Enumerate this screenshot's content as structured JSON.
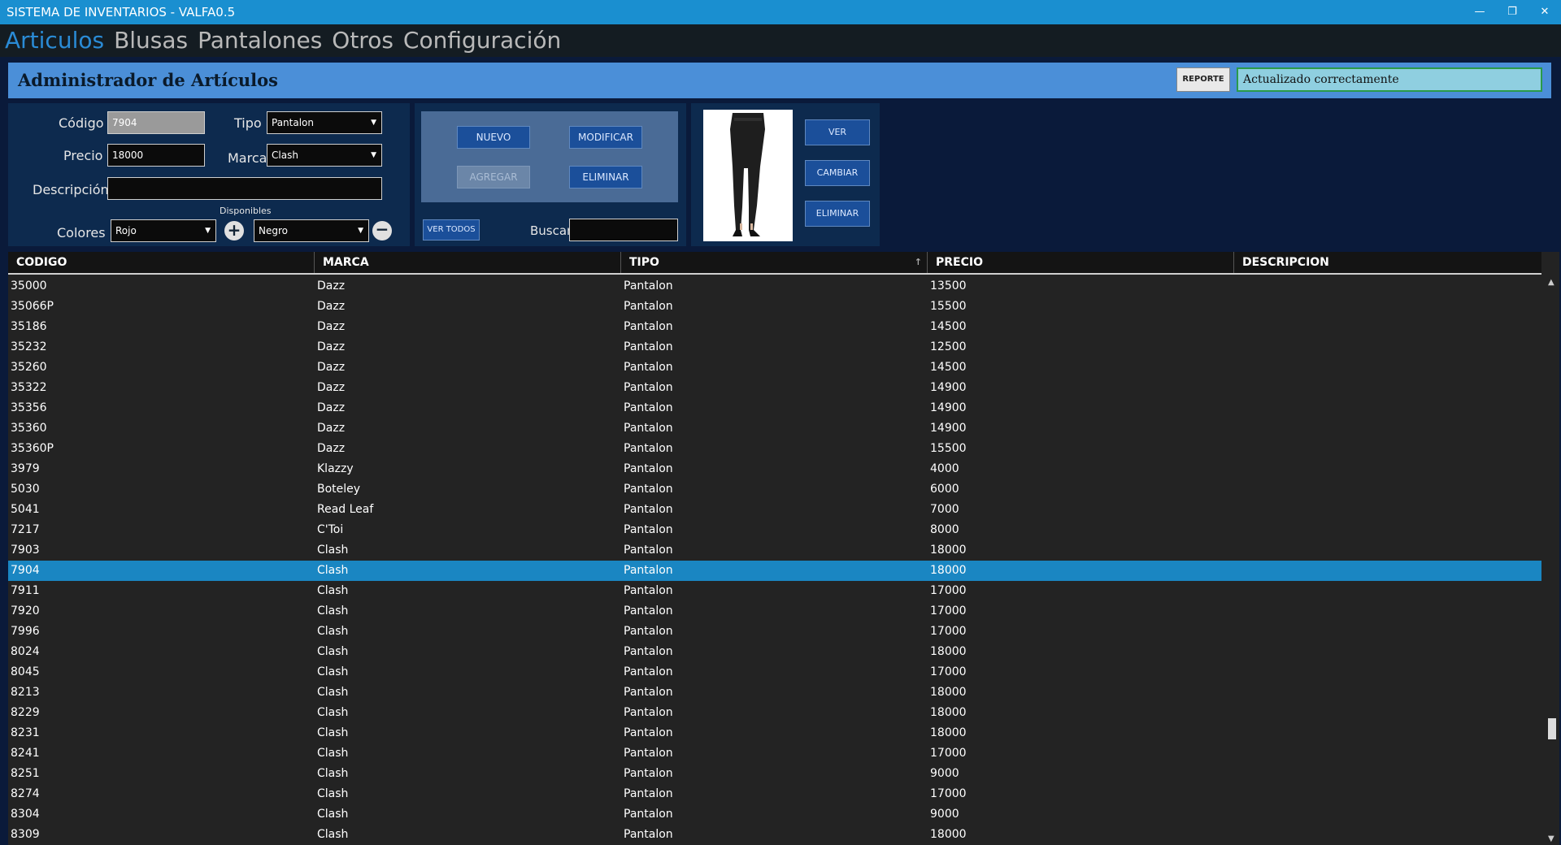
{
  "window": {
    "title": "SISTEMA DE INVENTARIOS - VALFA0.5"
  },
  "menu": {
    "items": [
      "Articulos",
      "Blusas",
      "Pantalones",
      "Otros",
      "Configuración"
    ],
    "active": "Articulos"
  },
  "header": {
    "title": "Administrador de Artículos",
    "report_button": "REPORTE",
    "status": "Actualizado correctamente"
  },
  "form": {
    "codigo_label": "Código",
    "codigo_value": "7904",
    "tipo_label": "Tipo",
    "tipo_value": "Pantalon",
    "precio_label": "Precio",
    "precio_value": "18000",
    "marca_label": "Marca",
    "marca_value": "Clash",
    "descripcion_label": "Descripción",
    "descripcion_value": "",
    "colores_label": "Colores",
    "colores_value": "Rojo",
    "disponibles_label": "Disponibles",
    "disponibles_value": "Negro"
  },
  "actions": {
    "nuevo": "NUEVO",
    "modificar": "MODIFICAR",
    "agregar": "AGREGAR",
    "eliminar": "ELIMINAR",
    "ver_todos": "VER TODOS",
    "buscar_label": "Buscar",
    "buscar_value": ""
  },
  "image_actions": {
    "ver": "VER",
    "cambiar": "CAMBIAR",
    "eliminar": "ELIMINAR"
  },
  "grid": {
    "columns": [
      "CODIGO",
      "MARCA",
      "TIPO",
      "PRECIO",
      "DESCRIPCION"
    ],
    "sorted_column": "TIPO",
    "selected_row": "7904",
    "rows": [
      [
        "35000",
        "Dazz",
        "Pantalon",
        "13500",
        ""
      ],
      [
        "35066P",
        "Dazz",
        "Pantalon",
        "15500",
        ""
      ],
      [
        "35186",
        "Dazz",
        "Pantalon",
        "14500",
        ""
      ],
      [
        "35232",
        "Dazz",
        "Pantalon",
        "12500",
        ""
      ],
      [
        "35260",
        "Dazz",
        "Pantalon",
        "14500",
        ""
      ],
      [
        "35322",
        "Dazz",
        "Pantalon",
        "14900",
        ""
      ],
      [
        "35356",
        "Dazz",
        "Pantalon",
        "14900",
        ""
      ],
      [
        "35360",
        "Dazz",
        "Pantalon",
        "14900",
        ""
      ],
      [
        "35360P",
        "Dazz",
        "Pantalon",
        "15500",
        ""
      ],
      [
        "3979",
        "Klazzy",
        "Pantalon",
        "4000",
        ""
      ],
      [
        "5030",
        "Boteley",
        "Pantalon",
        "6000",
        ""
      ],
      [
        "5041",
        "Read Leaf",
        "Pantalon",
        "7000",
        ""
      ],
      [
        "7217",
        "C'Toi",
        "Pantalon",
        "8000",
        ""
      ],
      [
        "7903",
        "Clash",
        "Pantalon",
        "18000",
        ""
      ],
      [
        "7904",
        "Clash",
        "Pantalon",
        "18000",
        ""
      ],
      [
        "7911",
        "Clash",
        "Pantalon",
        "17000",
        ""
      ],
      [
        "7920",
        "Clash",
        "Pantalon",
        "17000",
        ""
      ],
      [
        "7996",
        "Clash",
        "Pantalon",
        "17000",
        ""
      ],
      [
        "8024",
        "Clash",
        "Pantalon",
        "18000",
        ""
      ],
      [
        "8045",
        "Clash",
        "Pantalon",
        "17000",
        ""
      ],
      [
        "8213",
        "Clash",
        "Pantalon",
        "18000",
        ""
      ],
      [
        "8229",
        "Clash",
        "Pantalon",
        "18000",
        ""
      ],
      [
        "8231",
        "Clash",
        "Pantalon",
        "18000",
        ""
      ],
      [
        "8241",
        "Clash",
        "Pantalon",
        "17000",
        ""
      ],
      [
        "8251",
        "Clash",
        "Pantalon",
        "9000",
        ""
      ],
      [
        "8274",
        "Clash",
        "Pantalon",
        "17000",
        ""
      ],
      [
        "8304",
        "Clash",
        "Pantalon",
        "9000",
        ""
      ],
      [
        "8309",
        "Clash",
        "Pantalon",
        "18000",
        ""
      ]
    ]
  }
}
